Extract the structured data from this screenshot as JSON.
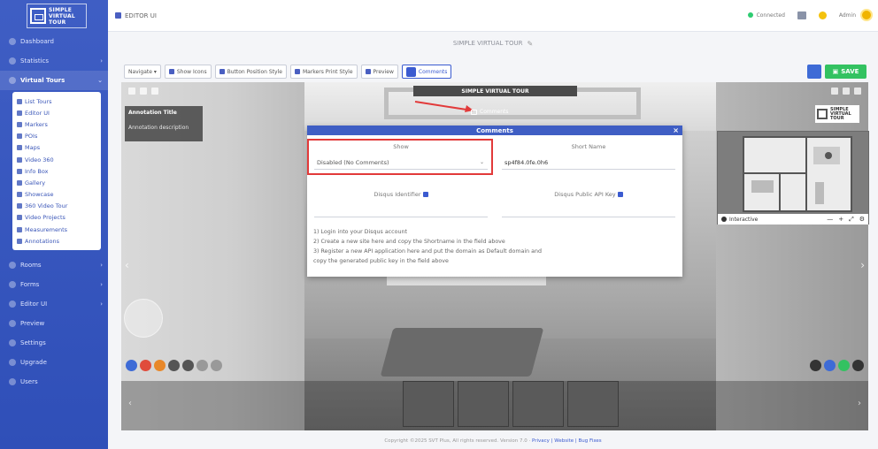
{
  "sidebar": {
    "logo_text": [
      "SIMPLE",
      "VIRTUAL",
      "TOUR"
    ],
    "nav": [
      {
        "label": "Dashboard",
        "has_arrow": false
      },
      {
        "label": "Statistics",
        "has_arrow": true
      }
    ],
    "virtual_tours": {
      "label": "Virtual Tours",
      "active": true
    },
    "submenu": [
      "List Tours",
      "Editor UI",
      "Markers",
      "POIs",
      "Maps",
      "Video 360",
      "Info Box",
      "Gallery",
      "Showcase",
      "360 Video Tour",
      "Video Projects",
      "Measurements",
      "Annotations"
    ],
    "nav_bottom": [
      {
        "label": "Rooms",
        "has_arrow": true
      },
      {
        "label": "Forms",
        "has_arrow": true
      },
      {
        "label": "Editor UI",
        "has_arrow": true
      },
      {
        "label": "Preview",
        "has_arrow": false
      },
      {
        "label": "Settings",
        "has_arrow": false
      },
      {
        "label": "Upgrade",
        "has_arrow": false
      },
      {
        "label": "Users",
        "has_arrow": false
      }
    ]
  },
  "topbar": {
    "breadcrumb": "EDITOR UI",
    "status": "Connected",
    "user_name": "Admin"
  },
  "tour_title": "SIMPLE VIRTUAL TOUR",
  "toolbar": {
    "buttons": [
      "Navigate ▾",
      "Show Icons",
      "Button Position Style",
      "Markers Print Style",
      "Preview",
      "Comments"
    ],
    "save_label": "SAVE"
  },
  "viewer": {
    "title": "SIMPLE VIRTUAL TOUR",
    "comments_label": "Comments",
    "annotation_title": "Annotation Title",
    "annotation_desc": "Annotation description",
    "logo_text": [
      "SIMPLE",
      "VIRTUAL",
      "TOUR"
    ],
    "map_label": "Interactive",
    "map_controls": [
      "—",
      "+",
      "⤢",
      "⚙"
    ],
    "left_icon_colors": [
      "#3e6bd6",
      "#e04c3c",
      "#e8882a",
      "#555555",
      "#555555",
      "#999999",
      "#999999"
    ],
    "right_icon_colors": [
      "#333333",
      "#3e6bd6",
      "#33c261",
      "#333333"
    ]
  },
  "dialog": {
    "title": "Comments",
    "show_label": "Show",
    "show_value": "Disabled (No Comments)",
    "shortname_label": "Short Name",
    "shortname_value": "sp4f84.0fe.0h6",
    "identifier_label": "Disqus Identifier",
    "publickey_label": "Disqus Public API Key",
    "help_lines": [
      "1) Login into your Disqus account",
      "2) Create a new site here and copy the Shortname in the field above",
      "3) Register a new API application here and put the domain as Default domain and",
      "copy the generated public key in the field above"
    ]
  },
  "footer": {
    "text": "Copyright ©2025 SVT Plus, All rights reserved. Version 7.0",
    "links": "Privacy | Website | Bug Fixes"
  }
}
